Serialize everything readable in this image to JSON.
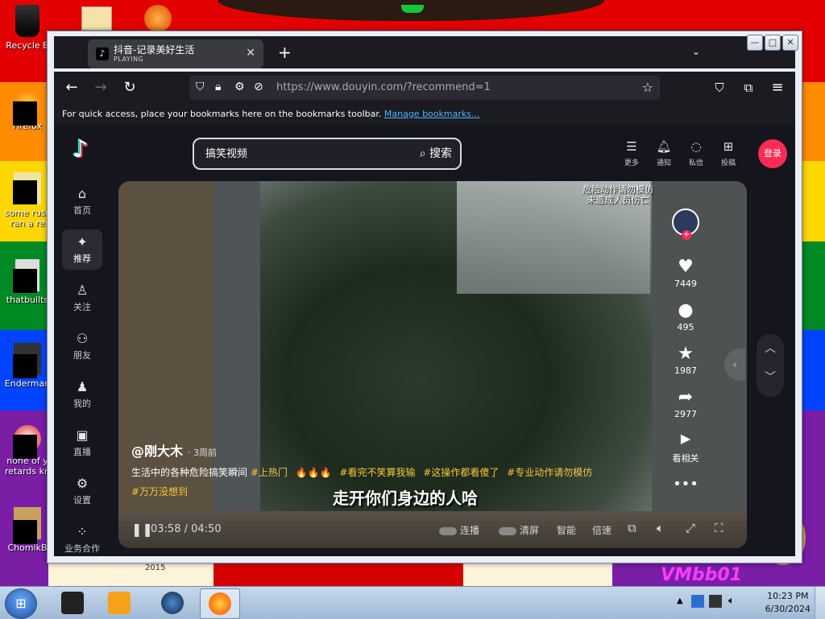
{
  "desktop": {
    "icons": [
      {
        "label": "Recycle B"
      },
      {
        "label": "Firefox"
      },
      {
        "label": "some russ",
        "label2": "ran a re"
      },
      {
        "label": "thatbuilts"
      },
      {
        "label": "Enderman"
      },
      {
        "label": "none of y",
        "label2": "retards kn"
      },
      {
        "label": "ChomikB"
      }
    ],
    "wallpaper_text": "VMbb01",
    "wallpaper_year": "2015"
  },
  "browser": {
    "tab": {
      "title": "抖音-记录美好生活",
      "status": "PLAYING"
    },
    "url": "https://www.douyin.com/?recommend=1",
    "bookmarks_hint": "For quick access, place your bookmarks here on the bookmarks toolbar.",
    "bookmarks_link": "Manage bookmarks..."
  },
  "douyin": {
    "search": {
      "value": "搞笑视频",
      "button": "搜索"
    },
    "top_actions": [
      {
        "icon": "menu-icon",
        "label": "更多"
      },
      {
        "icon": "bell-icon",
        "label": "通知"
      },
      {
        "icon": "message-icon",
        "label": "私信"
      },
      {
        "icon": "upload-icon",
        "label": "投稿"
      }
    ],
    "login": "登录",
    "sidebar": [
      {
        "icon": "home-icon",
        "label": "首页"
      },
      {
        "icon": "sparkle-icon",
        "label": "推荐",
        "active": true
      },
      {
        "icon": "follow-icon",
        "label": "关注"
      },
      {
        "icon": "friends-icon",
        "label": "朋友"
      },
      {
        "icon": "user-icon",
        "label": "我的"
      },
      {
        "icon": "live-icon",
        "label": "直播"
      },
      {
        "icon": "settings-icon",
        "label": "设置"
      },
      {
        "icon": "business-icon",
        "label": "业务合作"
      }
    ],
    "video": {
      "top_note_1": "危险动作请勿模仿",
      "top_note_2": "未造成人员伤亡",
      "subtitle": "走开你们身边的人哈",
      "author": "@刚大木",
      "posted": "· 3周前",
      "description": "生活中的各种危险搞笑瞬间",
      "tags": [
        "#上热门",
        "#看完不笑算我输",
        "#这操作都看傻了",
        "#专业动作请勿模仿",
        "#万万没想到"
      ],
      "likes": "7449",
      "comments": "495",
      "favorites": "1987",
      "shares": "2977",
      "related": "看相关",
      "time_current": "03:58",
      "time_total": "04:50",
      "controls": {
        "autoplay": "连播",
        "clear": "清屏",
        "smart": "智能",
        "speed": "倍速"
      }
    }
  },
  "taskbar": {
    "time": "10:23 PM",
    "date": "6/30/2024"
  }
}
